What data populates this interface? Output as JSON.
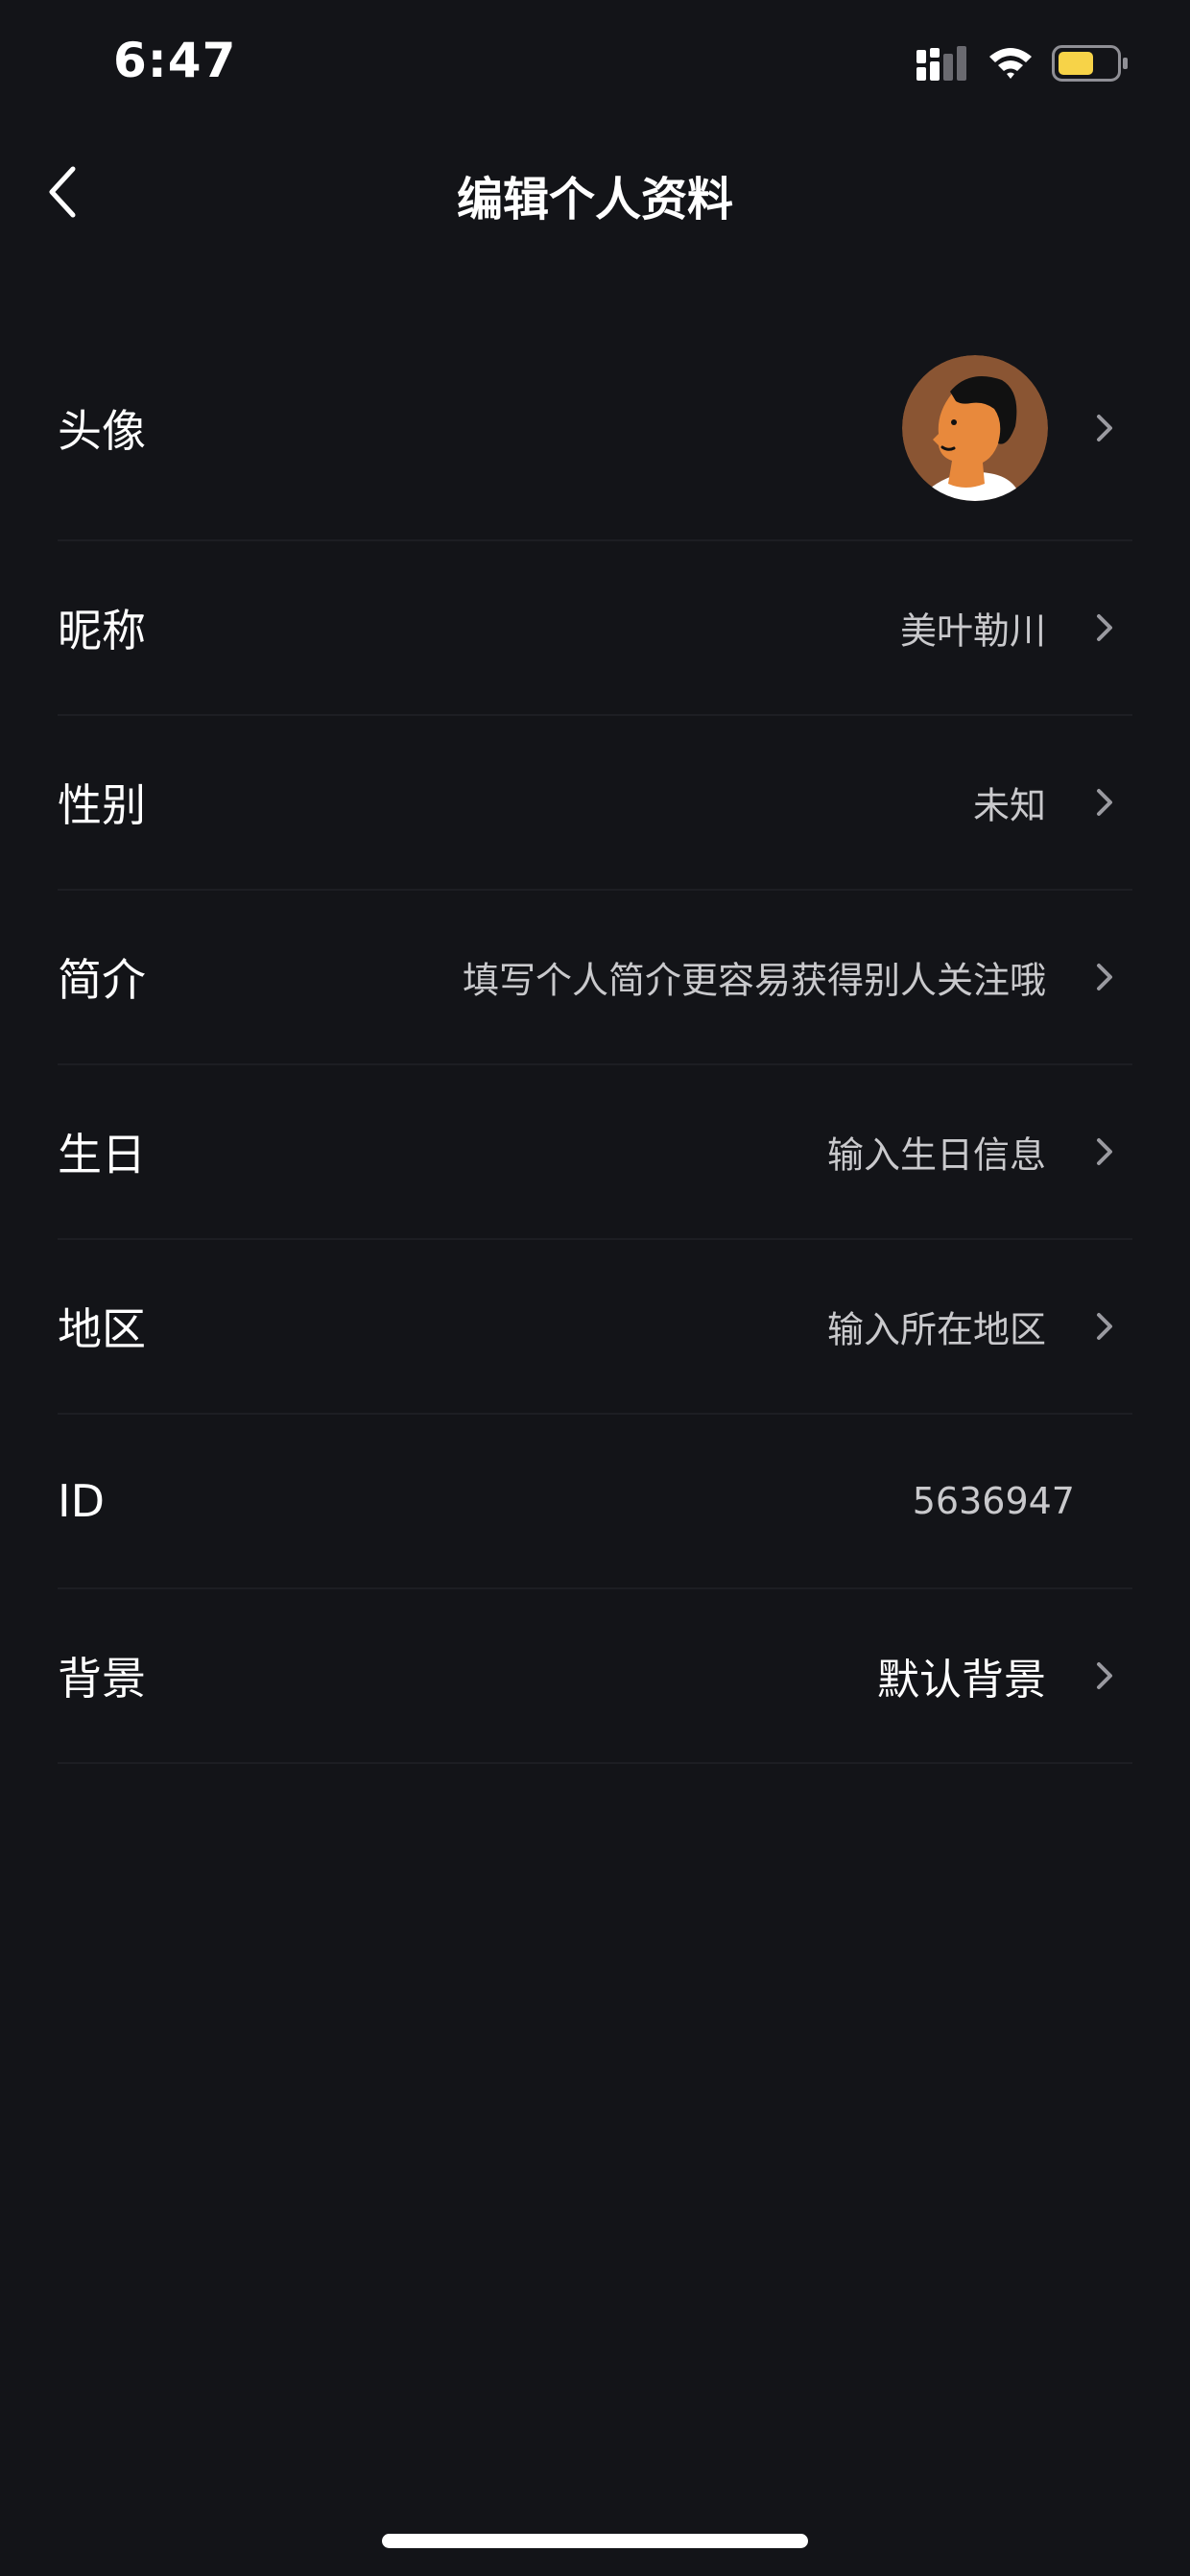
{
  "status_bar": {
    "time": "6:47",
    "icons": [
      "signal-icon",
      "wifi-icon",
      "battery-icon"
    ],
    "battery_color": "#f7d348"
  },
  "nav": {
    "title": "编辑个人资料",
    "back_icon": "chevron-left-icon"
  },
  "profile_rows": [
    {
      "label": "头像",
      "type": "avatar",
      "avatar_icon": "person-profile-avatar"
    },
    {
      "label": "昵称",
      "value": "美叶勒川"
    },
    {
      "label": "性别",
      "value": "未知"
    },
    {
      "label": "简介",
      "value": "填写个人简介更容易获得别人关注哦"
    },
    {
      "label": "生日",
      "value": "输入生日信息"
    },
    {
      "label": "地区",
      "value": "输入所在地区"
    },
    {
      "label": "ID",
      "value": "5636947"
    },
    {
      "label": "背景",
      "value": "默认背景"
    }
  ],
  "colors": {
    "background": "#131418",
    "divider": "#1d1e23",
    "secondary_text": "#c9c9cc",
    "chevron": "#9a9aa0",
    "avatar_bg": "#8a5533",
    "avatar_skin": "#e8893c"
  }
}
